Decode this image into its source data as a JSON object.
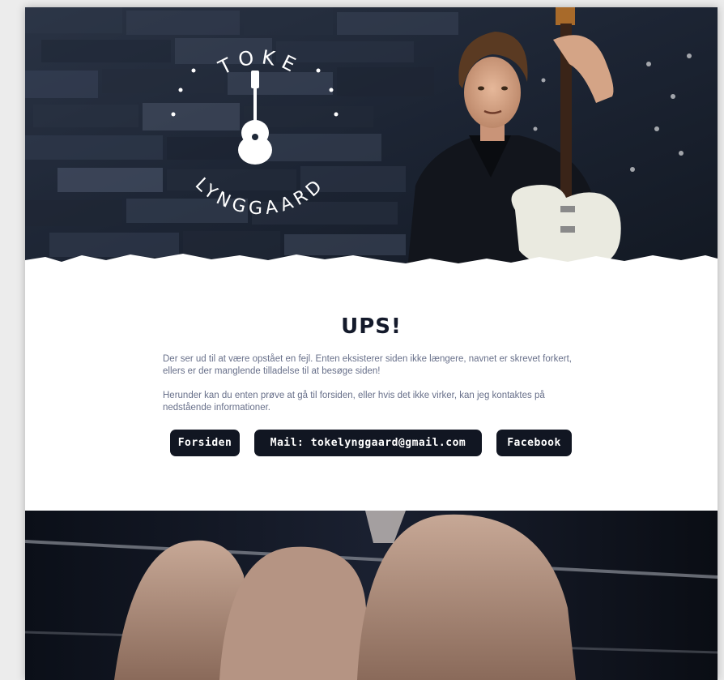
{
  "logo": {
    "top_text": "TOKE",
    "bottom_text": "LYNGGAARD"
  },
  "error": {
    "title": "UPS!",
    "paragraph1": "Der ser ud til at være opstået en fejl. Enten eksisterer siden ikke længere, navnet er skrevet forkert, ellers er der manglende tilladelse til at besøge siden!",
    "paragraph2": "Herunder kan du enten prøve at gå til forsiden, eller hvis det ikke virker, kan jeg kontaktes på nedstående informationer."
  },
  "buttons": {
    "home_label": "Forsiden",
    "mail_label": "Mail: tokelynggaard@gmail.com",
    "facebook_label": "Facebook"
  },
  "colors": {
    "button_bg": "#111622",
    "title_text": "#141a2b",
    "body_text": "#68708a",
    "hero_stone": "#1f2838"
  }
}
